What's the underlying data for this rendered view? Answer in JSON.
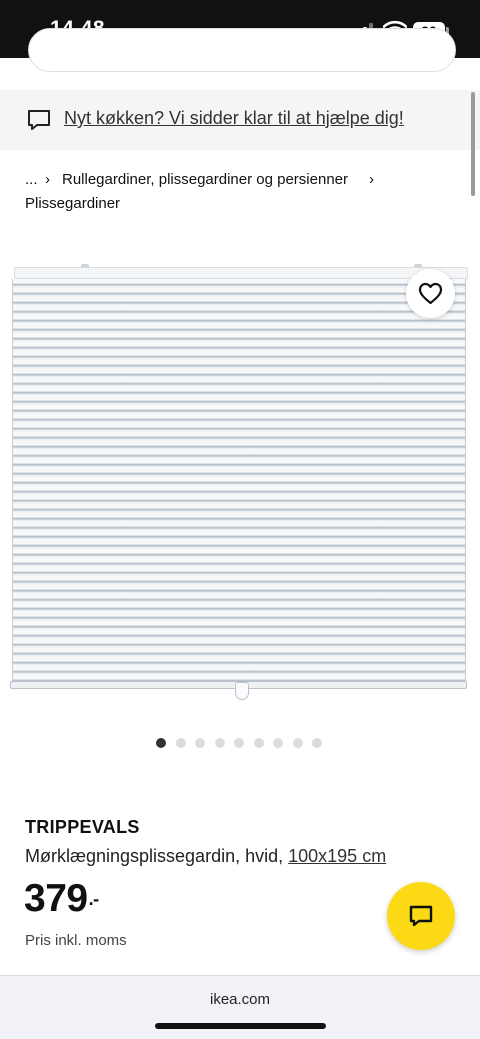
{
  "status_bar": {
    "time": "14.48",
    "battery": "90",
    "icons": [
      "signal-icon",
      "wifi-icon",
      "battery-icon"
    ]
  },
  "help_banner": {
    "icon": "chat-bubble-icon",
    "text": "Nyt køkken? Vi sidder klar til at hjælpe dig!"
  },
  "breadcrumb": {
    "ellipsis": "...",
    "separator": "›",
    "items": [
      "Rullegardiner, plissegardiner og persienner",
      "Plissegardiner"
    ]
  },
  "product": {
    "favorite_icon": "heart-icon",
    "carousel": {
      "total": 9,
      "active_index": 0
    },
    "name": "TRIPPEVALS",
    "description": "Mørklægningsplissegardin, hvid,",
    "size": "100x195 cm",
    "price": "379",
    "price_suffix": ".-",
    "vat_note": "Pris inkl. moms"
  },
  "chat": {
    "icon": "chat-icon",
    "color": "#FBD914"
  },
  "browser": {
    "url": "ikea.com"
  }
}
